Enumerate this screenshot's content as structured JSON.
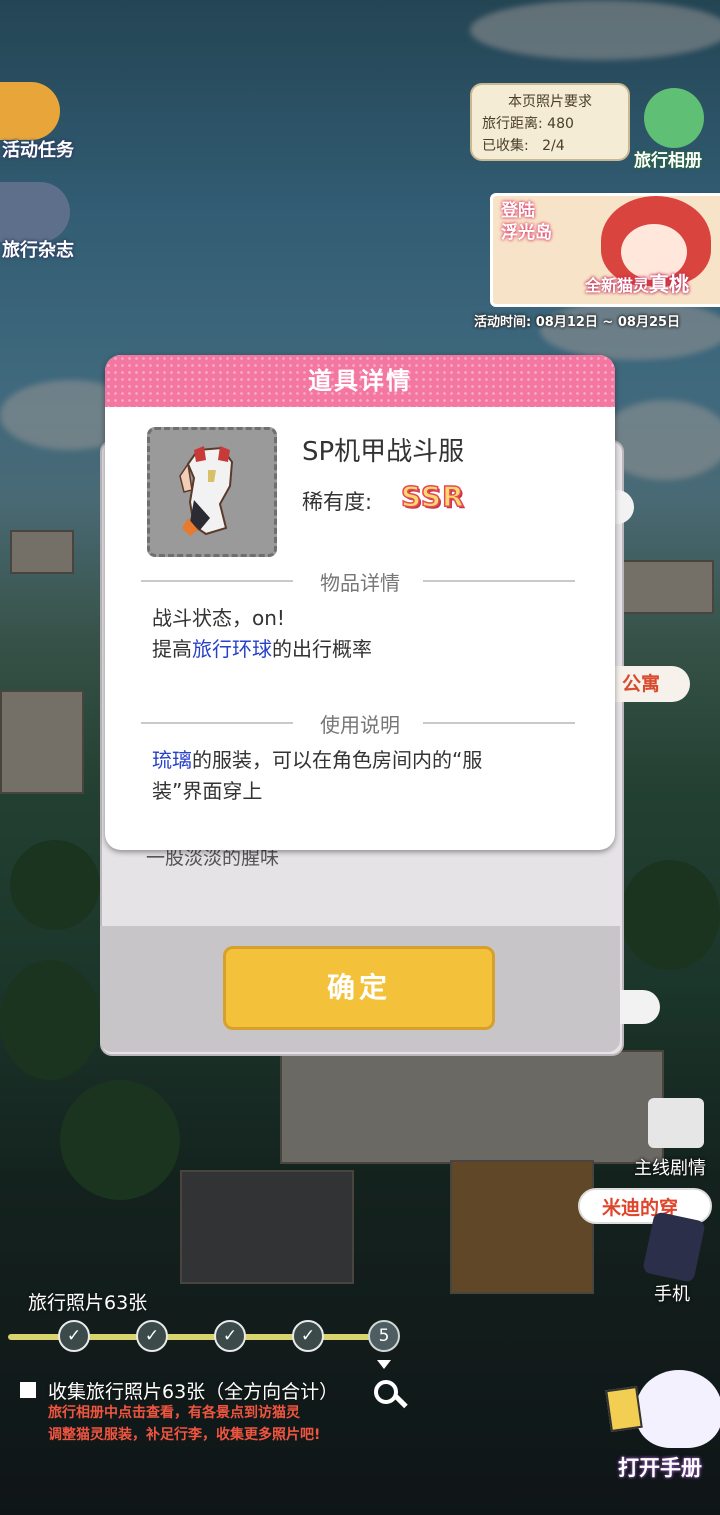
{
  "left_menu": {
    "activity_tasks": "活动任务",
    "travel_magazine": "旅行杂志"
  },
  "page_requirement": {
    "title": "本页照片要求",
    "distance_label": "旅行距离:",
    "distance_value": "480",
    "collected_label": "已收集:",
    "collected_value": "2/4"
  },
  "album_button": "旅行相册",
  "event_banner": {
    "line1": "登陆",
    "line2": "浮光岛",
    "caption_prefix": "全新猫灵",
    "caption_name": "真桃",
    "time": "活动时间: 08月12日 ~ 08月25日"
  },
  "background_dialog": {
    "location": "公寓",
    "text": "一股淡淡的腥味",
    "confirm": "确定"
  },
  "item_dialog": {
    "title": "道具详情",
    "item_name": "SP机甲战斗服",
    "rarity_label": "稀有度:",
    "rarity_value": "SSR",
    "details_header": "物品详情",
    "details_line1": "战斗状态，on!",
    "details_line2_pre": "提高",
    "details_line2_hl": "旅行环球",
    "details_line2_post": "的出行概率",
    "usage_header": "使用说明",
    "usage_hl": "琉璃",
    "usage_line1_post": "的服装，可以在角色房间内的“服",
    "usage_line2": "装”界面穿上"
  },
  "progress": {
    "label": "旅行照片63张",
    "current_node": "5",
    "goal_title": "收集旅行照片63张（全方向合计）",
    "goal_sub1": "旅行相册中点击查看，有各景点到访猫灵",
    "goal_sub2": "调整猫灵服装，补足行李，收集更多照片吧!"
  },
  "right_menu": {
    "main_story": "主线剧情",
    "midi": "米迪的穿",
    "phone": "手机",
    "open_handbook": "打开手册"
  },
  "colors": {
    "dialog_header": "#f477a1",
    "highlight": "#2742c9",
    "confirm": "#f3c13a",
    "rarity": "#ffd86b"
  }
}
